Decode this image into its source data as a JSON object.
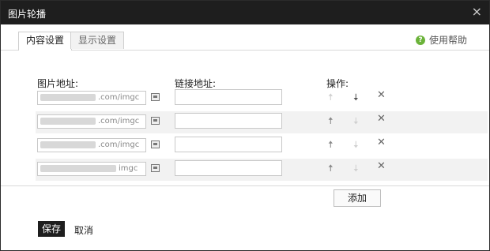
{
  "dialog": {
    "title": "图片轮播",
    "close_symbol": "×"
  },
  "tabs": [
    {
      "label": "内容设置",
      "active": true
    },
    {
      "label": "显示设置",
      "active": false
    }
  ],
  "help": {
    "label": "使用帮助",
    "icon": "question-circle-icon",
    "icon_glyph": "?",
    "color": "#6bb33a"
  },
  "columns": {
    "image_url": "图片地址:",
    "link_url": "链接地址:",
    "actions": "操作:"
  },
  "rows": [
    {
      "image_url": ".com/imgc",
      "link_url": "",
      "up_enabled": false,
      "down_enabled": true
    },
    {
      "image_url": ".com/imgc",
      "link_url": "",
      "up_enabled": true,
      "down_enabled": false
    },
    {
      "image_url": ".com/imgc",
      "link_url": "",
      "up_enabled": true,
      "down_enabled": false
    },
    {
      "image_url": "imgc",
      "link_url": "",
      "up_enabled": true,
      "down_enabled": false
    }
  ],
  "action_glyphs": {
    "up": "🠅",
    "down": "🠇",
    "delete": "✕"
  },
  "add_button": "添加",
  "footer": {
    "save": "保存",
    "cancel": "取消"
  }
}
